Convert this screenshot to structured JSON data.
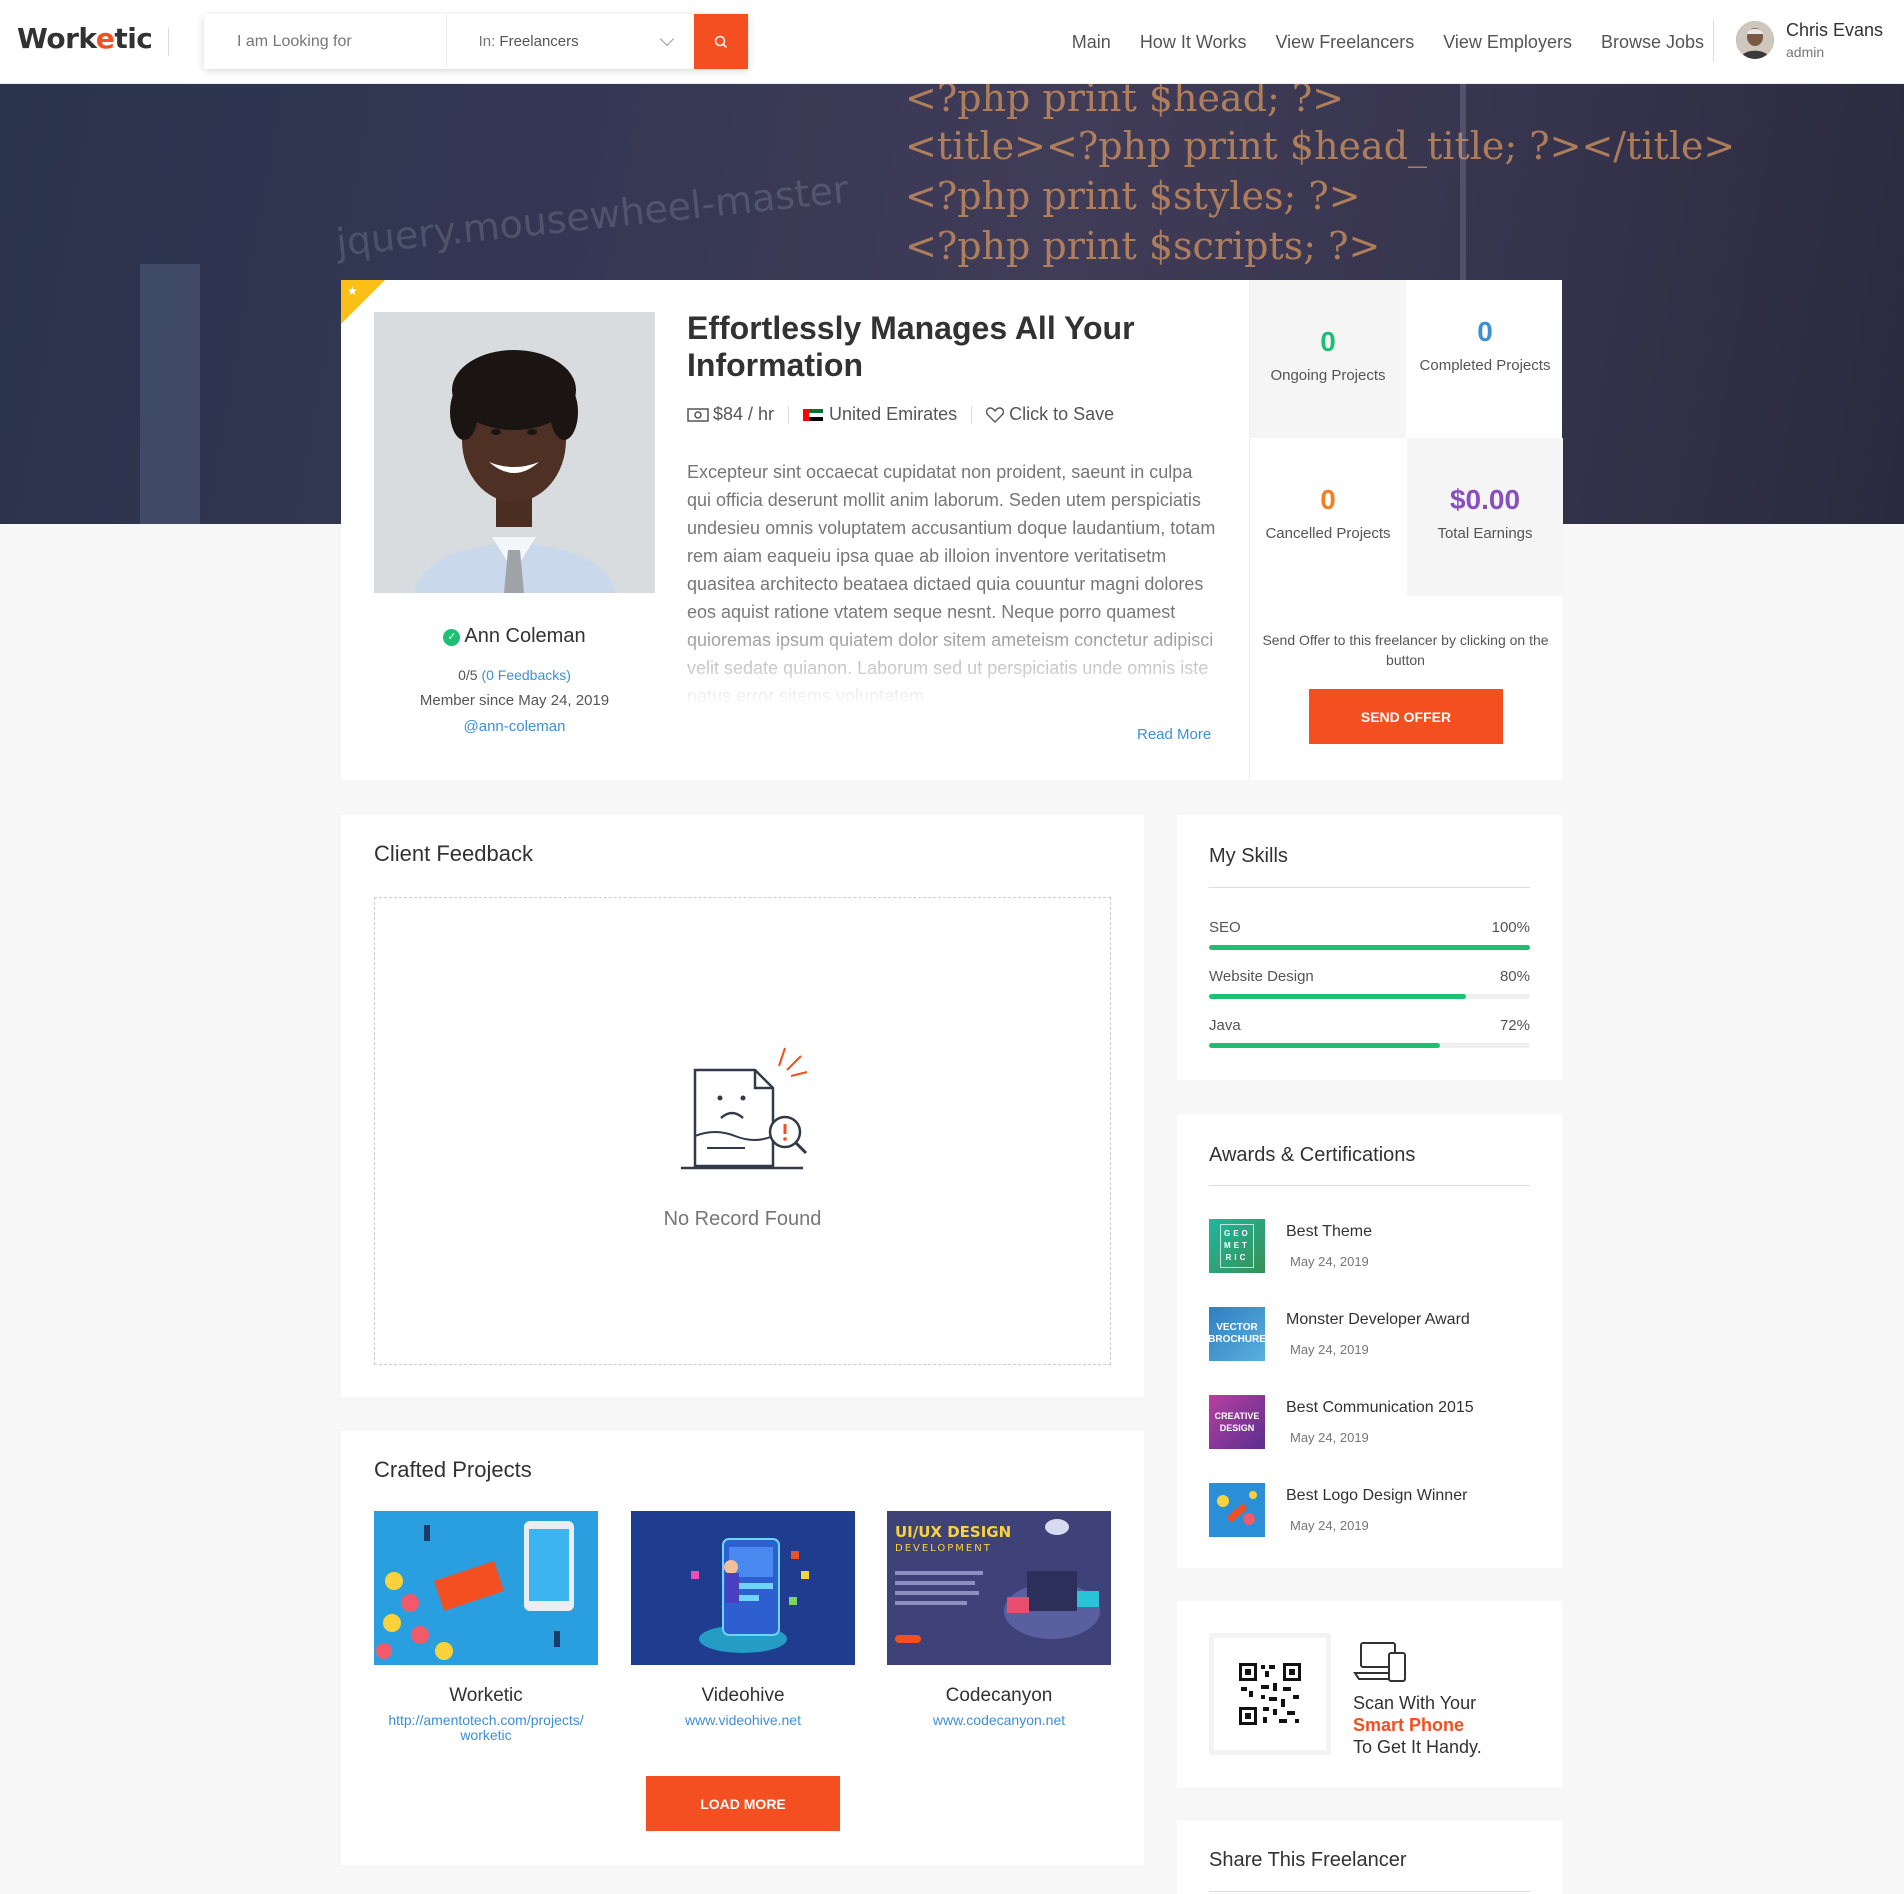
{
  "header": {
    "logo_prefix": "Work",
    "logo_e": "e",
    "logo_suffix": "tic",
    "search_placeholder": "I am Looking for",
    "search_filter_prefix": "In:",
    "search_filter_value": "Freelancers",
    "nav": [
      "Main",
      "How It Works",
      "View Freelancers",
      "View Employers",
      "Browse Jobs"
    ],
    "user_name": "Chris Evans",
    "user_role": "admin"
  },
  "banner": {
    "code_lines": [
      "<?php print $head; ?>",
      "<title><?php print $head_title; ?></title>",
      "<?php print $styles; ?>",
      "<?php print $scripts; ?>"
    ],
    "blur_text": "jquery.mousewheel-master"
  },
  "profile": {
    "title": "Effortlessly Manages All Your Information",
    "rate": "$84 / hr",
    "country": "United Emirates",
    "save": "Click to Save",
    "description": "Excepteur sint occaecat cupidatat non proident, saeunt in culpa qui officia deserunt mollit anim laborum. Seden utem perspiciatis undesieu omnis voluptatem accusantium doque laudantium, totam rem aiam eaqueiu ipsa quae ab illoion inventore veritatisetm quasitea architecto beataea dictaed quia couuntur magni dolores eos aquist ratione vtatem seque nesnt. Neque porro quamest quioremas ipsum quiatem dolor sitem ameteism conctetur adipisci velit sedate quianon. Laborum sed ut perspiciatis unde omnis iste natus error sitems voluptatem",
    "read_more": "Read More",
    "name": "Ann Coleman",
    "rating": "0/5",
    "feedbacks": "(0 Feedbacks)",
    "member_since": "Member since May 24, 2019",
    "handle": "@ann-coleman"
  },
  "stats": [
    {
      "value": "0",
      "label": "Ongoing Projects",
      "color": "#1dbf73"
    },
    {
      "value": "0",
      "label": "Completed Projects",
      "color": "#3d8fd6"
    },
    {
      "value": "0",
      "label": "Cancelled Projects",
      "color": "#f37f20"
    },
    {
      "value": "$0.00",
      "label": "Total Earnings",
      "color": "#8a4fbf"
    }
  ],
  "send_offer": {
    "text": "Send Offer to this freelancer by clicking on the button",
    "button": "SEND OFFER"
  },
  "feedback": {
    "title": "Client Feedback",
    "empty": "No Record Found"
  },
  "projects": {
    "title": "Crafted Projects",
    "items": [
      {
        "name": "Worketic",
        "url": "http://amentotech.com/projects/worketic"
      },
      {
        "name": "Videohive",
        "url": "www.videohive.net"
      },
      {
        "name": "Codecanyon",
        "url": "www.codecanyon.net"
      }
    ],
    "thumb3_title": "UI/UX DESIGN",
    "thumb3_sub": "DEVELOPMENT",
    "load_more": "LOAD MORE"
  },
  "skills": {
    "title": "My Skills",
    "items": [
      {
        "name": "SEO",
        "percent": "100%",
        "value": 100
      },
      {
        "name": "Website Design",
        "percent": "80%",
        "value": 80
      },
      {
        "name": "Java",
        "percent": "72%",
        "value": 72
      }
    ]
  },
  "awards": {
    "title": "Awards & Certifications",
    "items": [
      {
        "name": "Best Theme",
        "date": "May 24, 2019",
        "thumb": "GEO MET RIC",
        "color": "#1aa07a"
      },
      {
        "name": "Monster Developer Award",
        "date": "May 24, 2019",
        "thumb": "VECTOR BROCHURE",
        "color": "#2f7fbf"
      },
      {
        "name": "Best Communication 2015",
        "date": "May 24, 2019",
        "thumb": "CREATIVE DESIGN",
        "color": "#8a2f8f"
      },
      {
        "name": "Best Logo Design Winner",
        "date": "May 24, 2019",
        "thumb": "",
        "color": "#2a8fd6"
      }
    ]
  },
  "app": {
    "line1": "Scan With Your",
    "line2": "Smart Phone",
    "line3": "To Get It Handy."
  },
  "share": {
    "title": "Share This Freelancer"
  }
}
